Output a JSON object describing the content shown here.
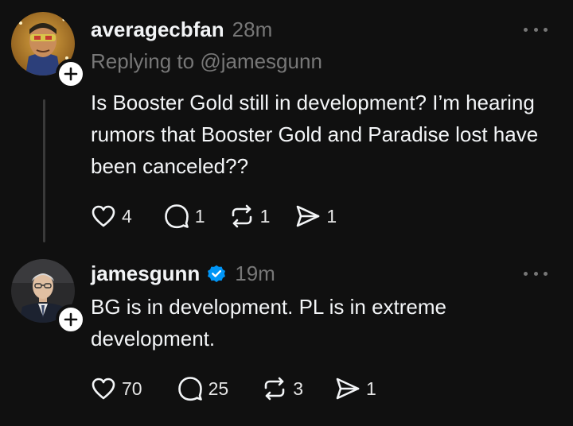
{
  "posts": [
    {
      "username": "averagecbfan",
      "timestamp": "28m",
      "reply_prefix": "Replying to ",
      "reply_handle": "@jamesgunn",
      "text": "Is Booster Gold still in development? I’m hearing rumors that Booster Gold and Paradise lost have been canceled??",
      "likes": "4",
      "comments": "1",
      "reposts": "1",
      "shares": "1",
      "verified": false,
      "avatar_icon": "comic-character-avatar"
    },
    {
      "username": "jamesgunn",
      "timestamp": "19m",
      "text": "BG is in development. PL is in extreme development.",
      "likes": "70",
      "comments": "25",
      "reposts": "3",
      "shares": "1",
      "verified": true,
      "avatar_icon": "man-in-suit-avatar"
    }
  ],
  "colors": {
    "background": "#101010",
    "primary_text": "#f3f5f7",
    "secondary_text": "#777777",
    "verified_blue": "#0095f6",
    "thread_line": "#3a3a3a"
  },
  "icons": {
    "like": "heart-icon",
    "comment": "comment-bubble-icon",
    "repost": "repost-arrows-icon",
    "share": "send-paper-plane-icon",
    "more": "more-dots-icon",
    "follow": "plus-icon",
    "verified": "verified-badge-icon"
  }
}
